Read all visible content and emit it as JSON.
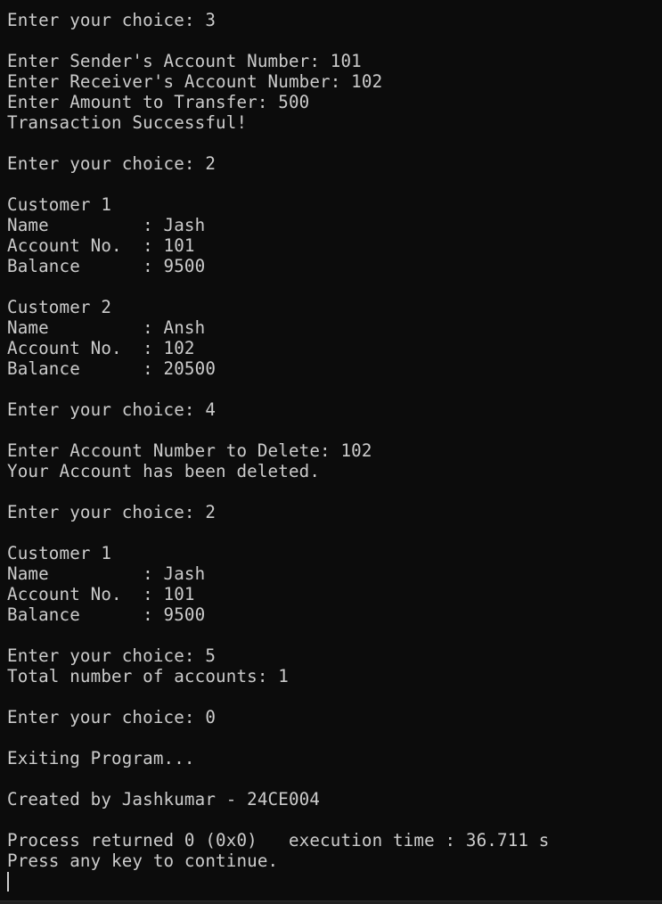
{
  "console": {
    "lines": [
      "Enter your choice: 3",
      "",
      "Enter Sender's Account Number: 101",
      "Enter Receiver's Account Number: 102",
      "Enter Amount to Transfer: 500",
      "Transaction Successful!",
      "",
      "Enter your choice: 2",
      "",
      "Customer 1",
      "Name         : Jash",
      "Account No.  : 101",
      "Balance      : 9500",
      "",
      "Customer 2",
      "Name         : Ansh",
      "Account No.  : 102",
      "Balance      : 20500",
      "",
      "Enter your choice: 4",
      "",
      "Enter Account Number to Delete: 102",
      "Your Account has been deleted.",
      "",
      "Enter your choice: 2",
      "",
      "Customer 1",
      "Name         : Jash",
      "Account No.  : 101",
      "Balance      : 9500",
      "",
      "Enter your choice: 5",
      "Total number of accounts: 1",
      "",
      "Enter your choice: 0",
      "",
      "Exiting Program...",
      "",
      "Created by Jashkumar - 24CE004",
      "",
      "Process returned 0 (0x0)   execution time : 36.711 s",
      "Press any key to continue."
    ]
  },
  "colors": {
    "background": "#0c0c0c",
    "text": "#cccccc"
  }
}
